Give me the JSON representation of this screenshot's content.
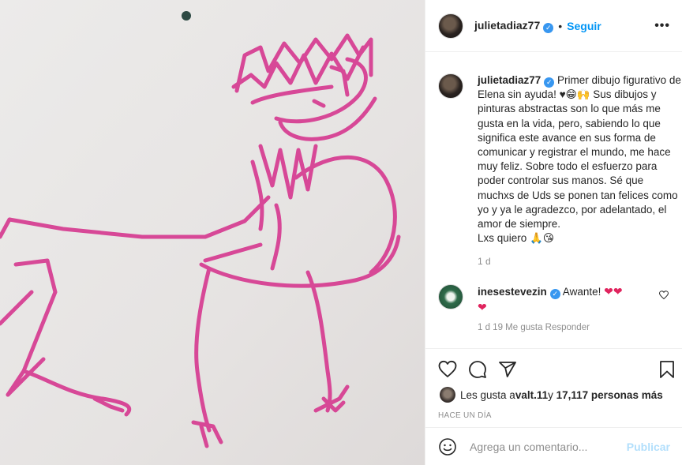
{
  "post": {
    "author": "julietadiaz77",
    "follow_label": "Seguir",
    "dot": "•",
    "more_label": "•••",
    "verified_glyph": "✓"
  },
  "caption": {
    "author": "julietadiaz77",
    "line1": " Primer dibujo figurativo de Elena sin ayuda! ♥😁🙌",
    "body": "Sus dibujos y pinturas abstractas son lo que más me gusta en la vida, pero, sabiendo lo que significa este avance en sus forma de comunicar y registrar el mundo, me hace muy feliz. Sobre todo el esfuerzo para poder controlar sus manos. Sé que muchxs de Uds se ponen tan felices como yo y ya le agradezco, por adelantado, el amor de siempre.",
    "closing": "Lxs quiero 🙏😘",
    "time": "1 d"
  },
  "comment": {
    "author": "inesestevezin",
    "text": " Awante! ",
    "hearts": "❤❤",
    "heart2": "❤",
    "meta": "1 d   19 Me gusta   Responder"
  },
  "likes": {
    "prefix": "Les gusta a ",
    "user": "valt.11",
    "mid": " y ",
    "count": "17,117 personas más"
  },
  "timestamp": "HACE UN DÍA",
  "composer": {
    "placeholder": "Agrega un comentario...",
    "submit_label": "Publicar"
  },
  "colors": {
    "accent": "#0095f6",
    "drawing": "#d6388f",
    "paper": "#eae8e7"
  }
}
